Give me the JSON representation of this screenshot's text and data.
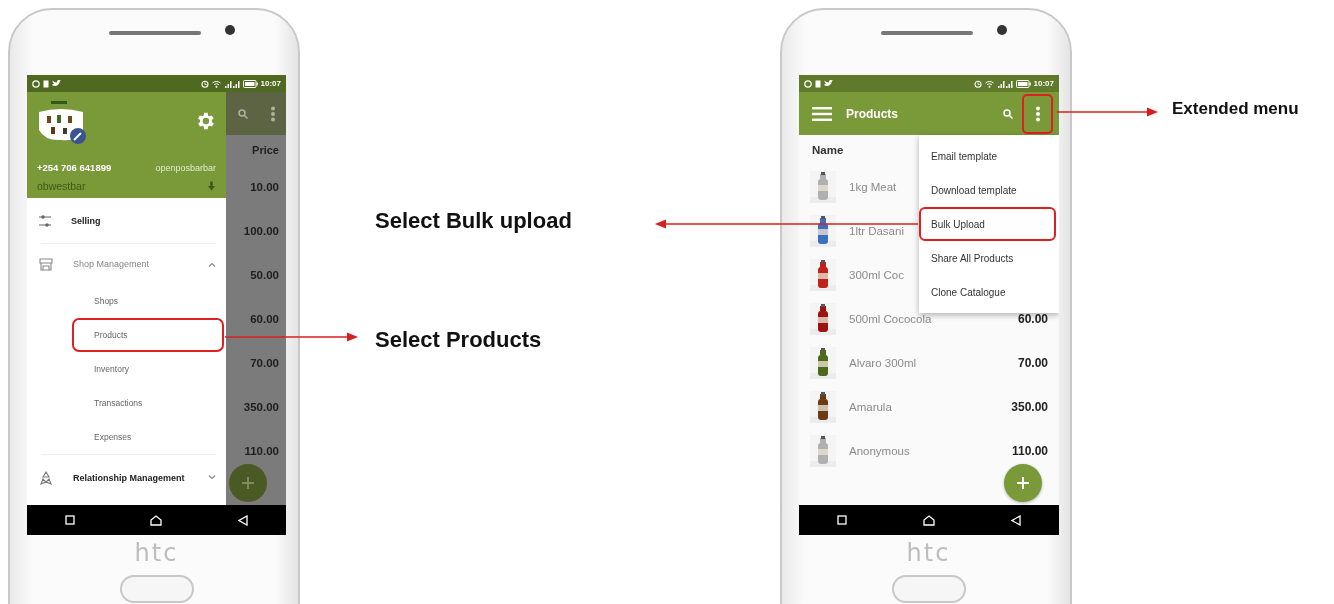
{
  "left_phone": {
    "brand": "htc",
    "status_bar": {
      "time": "10:07"
    },
    "drawer": {
      "phone": "+254 706 641899",
      "username": "openposbarbar",
      "shop": "obwestbar",
      "items": [
        {
          "kind": "link",
          "label": "Selling"
        },
        {
          "kind": "group",
          "label": "Shop Management",
          "expanded": true,
          "children": [
            {
              "label": "Shops",
              "highlighted": false
            },
            {
              "label": "Products",
              "highlighted": true
            },
            {
              "label": "Inventory",
              "highlighted": false
            },
            {
              "label": "Transactions",
              "highlighted": false
            },
            {
              "label": "Expenses",
              "highlighted": false
            }
          ]
        },
        {
          "kind": "group",
          "label": "Relationship Management",
          "expanded": false
        }
      ]
    },
    "background_list": {
      "column": "Price",
      "prices": [
        "10.00",
        "100.00",
        "50.00",
        "60.00",
        "70.00",
        "350.00",
        "110.00"
      ]
    }
  },
  "right_phone": {
    "brand": "htc",
    "status_bar": {
      "time": "10:07"
    },
    "app_bar": {
      "title": "Products",
      "more_highlighted": true
    },
    "table": {
      "column": "Name",
      "rows": [
        {
          "name": "1kg Meat"
        },
        {
          "name": "1ltr Dasani"
        },
        {
          "name": "300ml Coc"
        },
        {
          "name": "500ml Cococola",
          "price": "60.00"
        },
        {
          "name": "Alvaro 300ml",
          "price": "70.00"
        },
        {
          "name": "Amarula",
          "price": "350.00"
        },
        {
          "name": "Anonymous",
          "price": "110.00"
        }
      ]
    },
    "menu": {
      "items": [
        {
          "label": "Email template",
          "highlighted": false
        },
        {
          "label": "Download template",
          "highlighted": false
        },
        {
          "label": "Bulk Upload",
          "highlighted": true
        },
        {
          "label": "Share All Products",
          "highlighted": false
        },
        {
          "label": "Clone Catalogue",
          "highlighted": false
        }
      ]
    }
  },
  "annotations": [
    {
      "text": "Extended menu"
    },
    {
      "text": "Select Bulk upload"
    },
    {
      "text": "Select Products"
    }
  ]
}
